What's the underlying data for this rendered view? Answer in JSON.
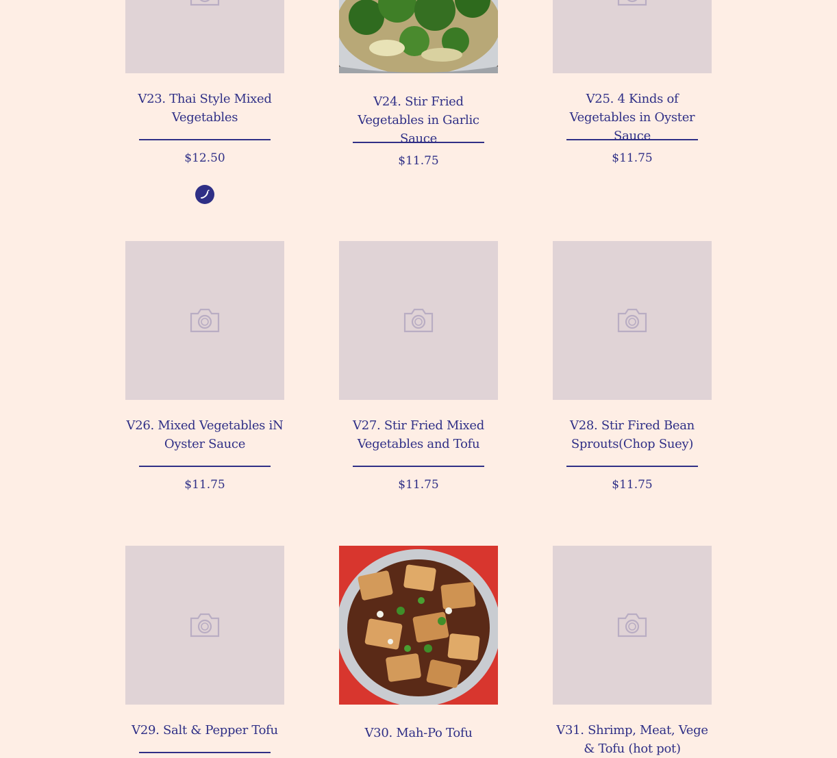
{
  "menu_items": [
    {
      "title": "V23. Thai Style Mixed Vegetables",
      "price": "$12.50",
      "badge_icon": "chili-pepper-icon"
    },
    {
      "title": "V24. Stir Fried Vegetables in Garlic Sauce",
      "price": "$11.75"
    },
    {
      "title": "V25. 4 Kinds of Vegetables in Oyster Sauce",
      "price": "$11.75"
    },
    {
      "title": "V26. Mixed Vegetables iN Oyster Sauce",
      "price": "$11.75"
    },
    {
      "title": "V27. Stir Fried Mixed Vegetables and Tofu",
      "price": "$11.75"
    },
    {
      "title": "V28. Stir Fired Bean Sprouts(Chop Suey)",
      "price": "$11.75"
    },
    {
      "title": "V29. Salt & Pepper Tofu"
    },
    {
      "title": "V30. Mah-Po Tofu"
    },
    {
      "title": "V31. Shrimp, Meat, Vege & Tofu (hot pot)"
    }
  ],
  "colors": {
    "background": "#feeee5",
    "accent": "#2f2f86",
    "placeholder": "#e0d3d6"
  },
  "icons": [
    "camera-placeholder-icon",
    "chili-pepper-icon"
  ]
}
